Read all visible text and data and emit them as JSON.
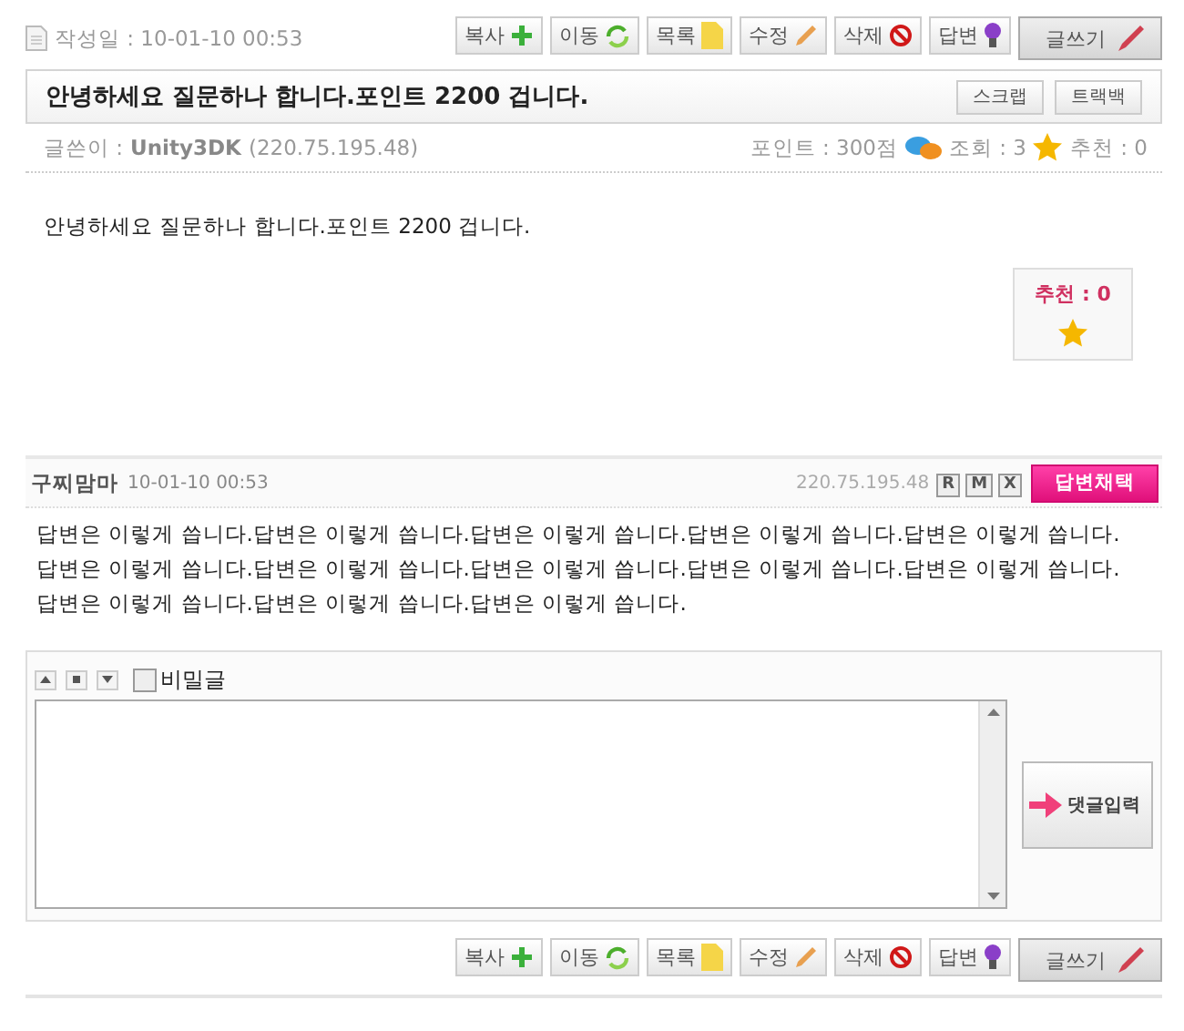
{
  "top_toolbar": {
    "date": "작성일 : 10-01-10 00:53",
    "buttons": [
      {
        "label": "복사",
        "kind": "copy"
      },
      {
        "label": "이동",
        "kind": "move"
      },
      {
        "label": "목록",
        "kind": "list"
      },
      {
        "label": "수정",
        "kind": "edit"
      },
      {
        "label": "삭제",
        "kind": "delete"
      },
      {
        "label": "답변",
        "kind": "reply"
      },
      {
        "label": "글쓰기",
        "kind": "write"
      }
    ]
  },
  "post": {
    "title": "안녕하세요 질문하나 합니다.포인트 2200 겁니다.",
    "title_buttons": [
      "스크랩",
      "트랙백"
    ],
    "author_label": "글쓴이 :",
    "author": "Unity3DK",
    "ip": "(220.75.195.48)",
    "points": "포인트 : 300점",
    "views": "조회 : 3",
    "recommend": "추천 : 0",
    "body": "안녕하세요 질문하나 합니다.포인트 2200 겁니다.",
    "recommend_box": "추천 : 0"
  },
  "comments": [
    {
      "author": "구찌맘마",
      "date": "10-01-10 00:53",
      "ip": "220.75.195.48",
      "mini_buttons": [
        "R",
        "M",
        "X"
      ],
      "accept_button": "답변채택",
      "text": "답변은 이렇게 씁니다.답변은 이렇게 씁니다.답변은 이렇게 씁니다.답변은 이렇게 씁니다.답변은 이렇게 씁니다.답변은 이렇게 씁니다.답변은 이렇게 씁니다.답변은 이렇게 씁니다.답변은 이렇게 씁니다.답변은 이렇게 씁니다.답변은 이렇게 씁니다.답변은 이렇게 씁니다.답변은 이렇게 씁니다."
    }
  ],
  "comment_form": {
    "secret": {
      "label": "비밀글",
      "checked": false
    },
    "submit": "댓글입력"
  },
  "bottom_toolbar": {
    "buttons": [
      {
        "label": "복사",
        "kind": "copy"
      },
      {
        "label": "이동",
        "kind": "move"
      },
      {
        "label": "목록",
        "kind": "list"
      },
      {
        "label": "수정",
        "kind": "edit"
      },
      {
        "label": "삭제",
        "kind": "delete"
      },
      {
        "label": "답변",
        "kind": "reply"
      },
      {
        "label": "글쓰기",
        "kind": "write"
      }
    ]
  }
}
